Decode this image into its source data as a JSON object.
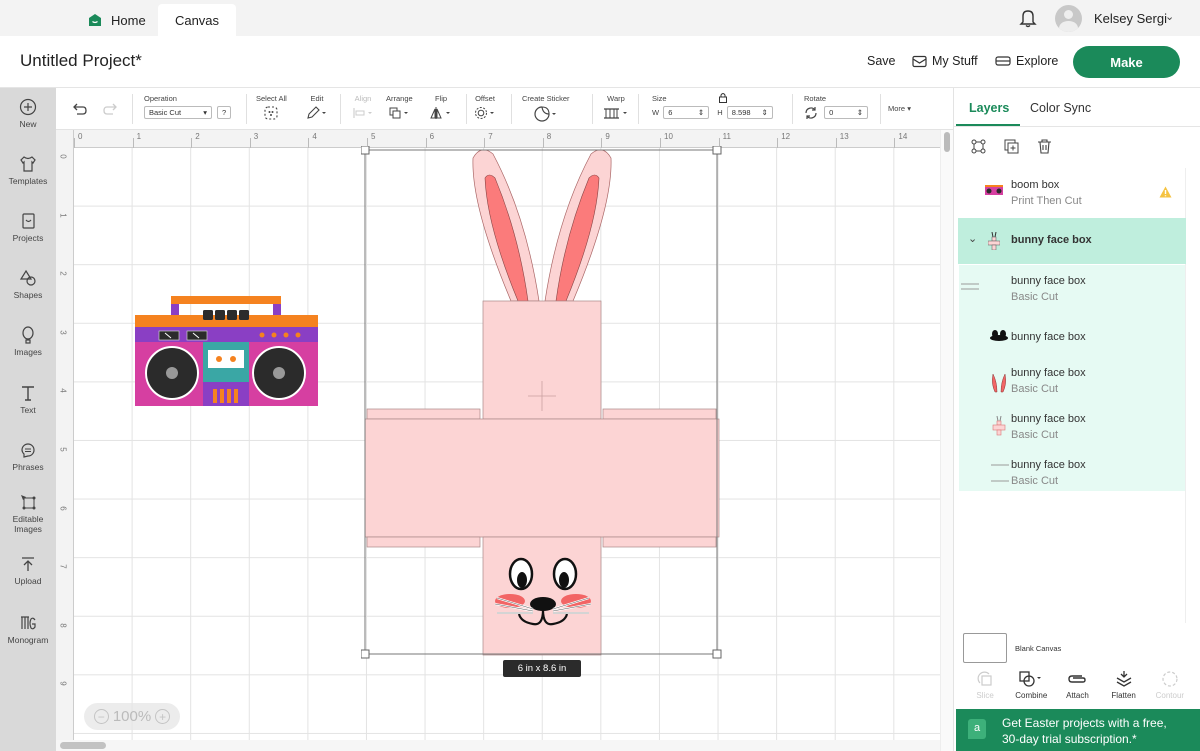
{
  "topbar": {
    "tabs": [
      {
        "label": "Home",
        "icon": "home-icon"
      },
      {
        "label": "Canvas"
      }
    ],
    "user_name": "Kelsey Sergi",
    "notifications_icon": "bell-icon"
  },
  "header": {
    "project_title": "Untitled Project*",
    "save_label": "Save",
    "mystuff_label": "My Stuff",
    "explore_label": "Explore",
    "make_label": "Make",
    "brand_color": "#1b8a5a"
  },
  "sidebar": {
    "items": [
      {
        "label": "New",
        "icon": "plus-circle-icon"
      },
      {
        "label": "Templates",
        "icon": "tshirt-icon"
      },
      {
        "label": "Projects",
        "icon": "projects-icon"
      },
      {
        "label": "Shapes",
        "icon": "shapes-icon"
      },
      {
        "label": "Images",
        "icon": "balloon-icon"
      },
      {
        "label": "Text",
        "icon": "text-icon"
      },
      {
        "label": "Phrases",
        "icon": "speech-bubble-icon"
      },
      {
        "label": "Editable",
        "label2": "Images",
        "icon": "editable-images-icon"
      },
      {
        "label": "Upload",
        "icon": "upload-icon"
      },
      {
        "label": "Monogram",
        "icon": "monogram-icon"
      }
    ]
  },
  "toolbar": {
    "operation_label": "Operation",
    "operation_value": "Basic Cut",
    "help_label": "?",
    "select_all_label": "Select All",
    "edit_label": "Edit",
    "align_label": "Align",
    "arrange_label": "Arrange",
    "flip_label": "Flip",
    "offset_label": "Offset",
    "create_sticker_label": "Create Sticker",
    "warp_label": "Warp",
    "size_label": "Size",
    "w_label": "W",
    "w_value": "6",
    "h_label": "H",
    "h_value": "8.598",
    "rotate_label": "Rotate",
    "rotate_value": "0",
    "more_label": "More"
  },
  "canvas": {
    "h_ruler": [
      "0",
      "1",
      "2",
      "3",
      "4",
      "5",
      "6",
      "7",
      "8",
      "9",
      "10",
      "11",
      "12",
      "13",
      "14"
    ],
    "v_ruler": [
      "0",
      "1",
      "2",
      "3",
      "4",
      "5",
      "6",
      "7",
      "8",
      "9"
    ],
    "size_badge": "6  in x 8.6  in",
    "zoom_level": "100%",
    "bunny_colors": {
      "pink": "#fcd4d4",
      "ear_inner": "#fb7b7b",
      "cheek": "#f26565"
    },
    "boombox_colors": {
      "body": "#d63fa1",
      "top": "#f5821f",
      "purple": "#8a3fc4",
      "teal": "#3aa7a5",
      "speaker": "#2b2b2b"
    }
  },
  "layers_panel": {
    "tabs": [
      "Layers",
      "Color Sync"
    ],
    "layers": [
      {
        "name": "boom box",
        "sub": "Print Then Cut",
        "warning": true
      },
      {
        "name": "bunny face box",
        "group": true,
        "expanded": true
      },
      {
        "name": "bunny face box",
        "sub": "Basic Cut"
      },
      {
        "name": "bunny face box",
        "collapsed_group": true
      },
      {
        "name": "bunny face box",
        "sub": "Basic Cut"
      },
      {
        "name": "bunny face box",
        "sub": "Basic Cut"
      },
      {
        "name": "bunny face box",
        "sub": "Basic Cut"
      }
    ],
    "blank_canvas_label": "Blank Canvas",
    "tools": [
      {
        "label": "Slice",
        "enabled": false
      },
      {
        "label": "Combine",
        "enabled": true
      },
      {
        "label": "Attach",
        "enabled": true
      },
      {
        "label": "Flatten",
        "enabled": true
      },
      {
        "label": "Contour",
        "enabled": false
      }
    ],
    "promo_line1": "Get Easter projects with a free,",
    "promo_line2": "30-day trial subscription.*",
    "promo_icon_letter": "a"
  }
}
